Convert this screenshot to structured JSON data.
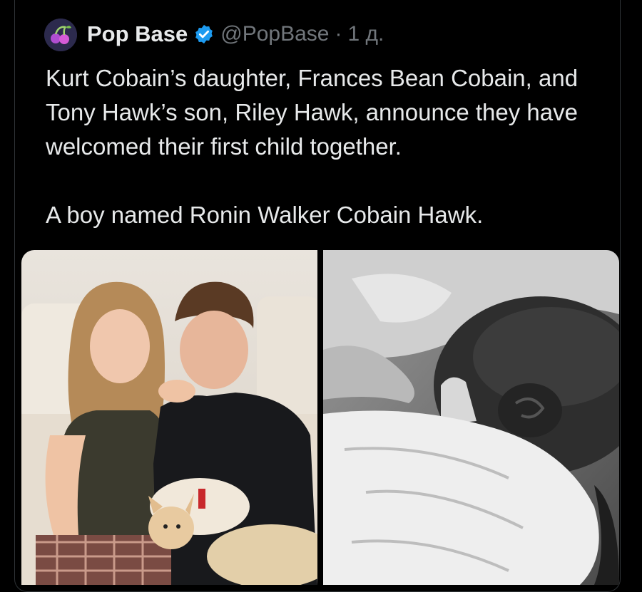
{
  "tweet": {
    "author": {
      "name": "Pop Base",
      "handle": "@PopBase",
      "separator": "·",
      "time": "1 д.",
      "verified_icon": "verified-badge-icon"
    },
    "text": [
      "Kurt Cobain’s daughter, Frances Bean Cobain, and Tony Hawk’s son, Riley Hawk, announce they have welcomed their first child together.",
      "A boy named Ronin Walker Cobain Hawk."
    ],
    "media": [
      {
        "kind": "photo",
        "icon": "couple-with-dog-photo"
      },
      {
        "kind": "photo",
        "icon": "newborn-black-and-white-photo"
      }
    ]
  },
  "colors": {
    "background": "#000000",
    "text": "#e7e9ea",
    "secondary": "#71767b",
    "verified": "#1d9bf0"
  }
}
